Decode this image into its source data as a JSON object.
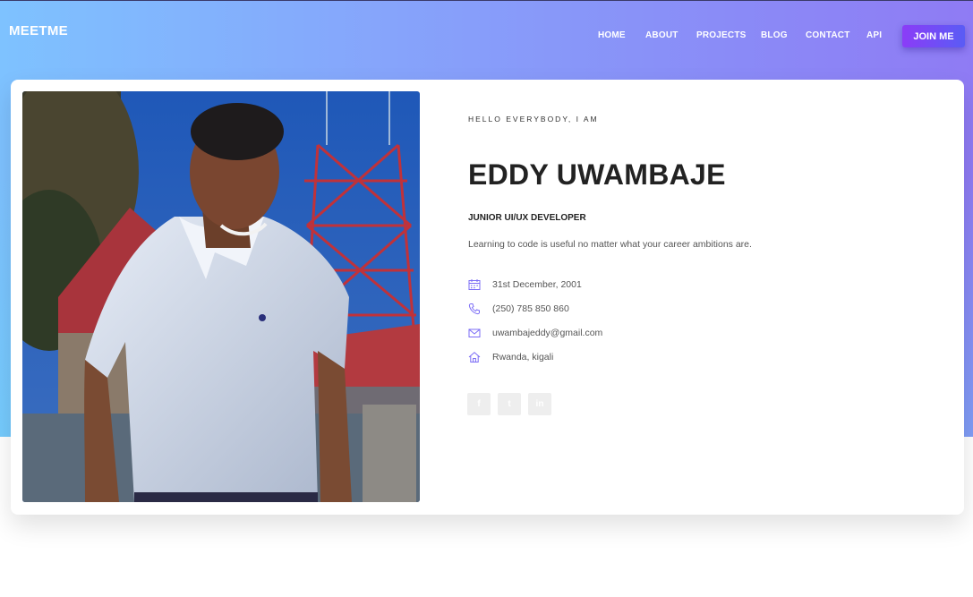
{
  "header": {
    "brand": "MEETME",
    "nav": [
      "HOME",
      "ABOUT",
      "PROJECTS",
      "BLOG",
      "CONTACT",
      "API"
    ],
    "join_label": "JOIN ME"
  },
  "profile": {
    "intro": "HELLO EVERYBODY, I AM",
    "name": "EDDY UWAMBAJE",
    "role": "JUNIOR UI/UX DEVELOPER",
    "tagline": "Learning to code is useful no matter what your career ambitions are.",
    "details": [
      {
        "icon": "calendar-icon",
        "text": "31st December, 2001"
      },
      {
        "icon": "phone-icon",
        "text": "(250) 785 850 860"
      },
      {
        "icon": "mail-icon",
        "text": "uwambajeddy@gmail.com"
      },
      {
        "icon": "home-icon",
        "text": "Rwanda, kigali"
      }
    ],
    "social": [
      {
        "icon": "facebook-icon",
        "glyph": "f"
      },
      {
        "icon": "twitter-icon",
        "glyph": "t"
      },
      {
        "icon": "linkedin-icon",
        "glyph": "in"
      }
    ]
  },
  "colors": {
    "accent": "#7b6cf6",
    "gradient_start": "#7ec2ff",
    "gradient_end": "#8f7bf4",
    "button_start": "#8b3cf7",
    "button_end": "#5a5cf5"
  }
}
